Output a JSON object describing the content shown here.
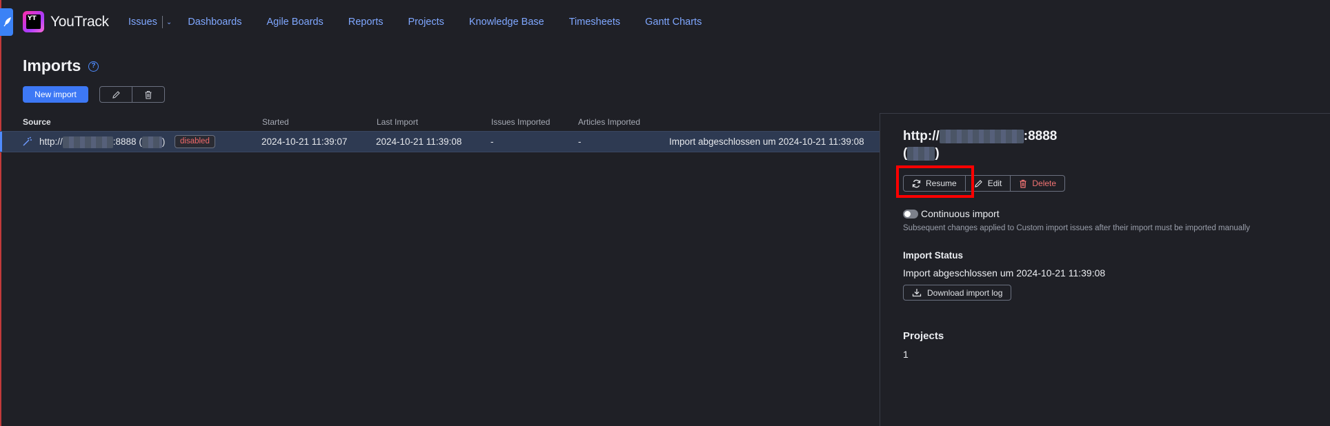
{
  "app": {
    "name": "YouTrack",
    "logo_text": "YT"
  },
  "nav": {
    "issues": "Issues",
    "items": [
      "Dashboards",
      "Agile Boards",
      "Reports",
      "Projects",
      "Knowledge Base",
      "Timesheets",
      "Gantt Charts"
    ]
  },
  "page": {
    "title": "Imports",
    "help_glyph": "?"
  },
  "toolbar": {
    "new_import": "New import"
  },
  "table": {
    "headers": [
      "Source",
      "Started",
      "Last Import",
      "Issues Imported",
      "Articles Imported"
    ],
    "rows": [
      {
        "source_prefix": "http://",
        "source_suffix": ":8888 (",
        "source_close": ")",
        "badge": "disabled",
        "started": "2024-10-21 11:39:07",
        "last_import": "2024-10-21 11:39:08",
        "issues_imported": "-",
        "articles_imported": "-",
        "status": "Import abgeschlossen um 2024-10-21 11:39:08"
      }
    ]
  },
  "panel": {
    "title_prefix": "http://",
    "title_suffix": ":8888",
    "title_open": "(",
    "title_close": ")",
    "resume": "Resume",
    "edit": "Edit",
    "delete": "Delete",
    "continuous_label": "Continuous import",
    "continuous_enabled": false,
    "continuous_sub": "Subsequent changes applied to Custom import issues after their import must be imported manually",
    "status_heading": "Import Status",
    "status_text": "Import abgeschlossen um 2024-10-21 11:39:08",
    "download_log": "Download import log",
    "projects_heading": "Projects",
    "projects_count": "1"
  },
  "colors": {
    "accent": "#3d78f5",
    "danger": "#f27474",
    "highlight": "#ff0000",
    "selected_row": "#2e3a52"
  }
}
